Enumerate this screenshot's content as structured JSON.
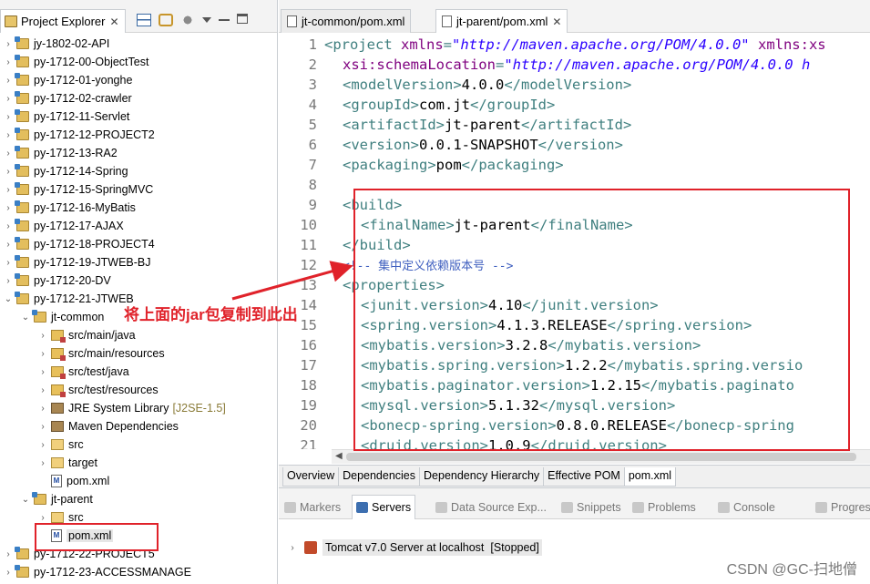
{
  "explorer": {
    "tab_label": "Project Explorer",
    "close_glyph": "✕",
    "tree": [
      {
        "label": "jy-1802-02-API",
        "type": "project",
        "indent": 0,
        "arrow": "›"
      },
      {
        "label": "py-1712-00-ObjectTest",
        "type": "project",
        "indent": 0,
        "arrow": "›"
      },
      {
        "label": "py-1712-01-yonghe",
        "type": "project",
        "indent": 0,
        "arrow": "›"
      },
      {
        "label": "py-1712-02-crawler",
        "type": "project",
        "indent": 0,
        "arrow": "›"
      },
      {
        "label": "py-1712-11-Servlet",
        "type": "project",
        "indent": 0,
        "arrow": "›"
      },
      {
        "label": "py-1712-12-PROJECT2",
        "type": "project",
        "indent": 0,
        "arrow": "›"
      },
      {
        "label": "py-1712-13-RA2",
        "type": "project",
        "indent": 0,
        "arrow": "›"
      },
      {
        "label": "py-1712-14-Spring",
        "type": "project",
        "indent": 0,
        "arrow": "›"
      },
      {
        "label": "py-1712-15-SpringMVC",
        "type": "project",
        "indent": 0,
        "arrow": "›"
      },
      {
        "label": "py-1712-16-MyBatis",
        "type": "project",
        "indent": 0,
        "arrow": "›"
      },
      {
        "label": "py-1712-17-AJAX",
        "type": "project",
        "indent": 0,
        "arrow": "›"
      },
      {
        "label": "py-1712-18-PROJECT4",
        "type": "project",
        "indent": 0,
        "arrow": "›"
      },
      {
        "label": "py-1712-19-JTWEB-BJ",
        "type": "project",
        "indent": 0,
        "arrow": "›"
      },
      {
        "label": "py-1712-20-DV",
        "type": "project",
        "indent": 0,
        "arrow": "›"
      },
      {
        "label": "py-1712-21-JTWEB",
        "type": "project",
        "indent": 0,
        "arrow": "⌄"
      },
      {
        "label": "jt-common",
        "type": "project",
        "indent": 1,
        "arrow": "⌄"
      },
      {
        "label": "src/main/java",
        "type": "srcfolder",
        "indent": 2,
        "arrow": "›"
      },
      {
        "label": "src/main/resources",
        "type": "srcfolder",
        "indent": 2,
        "arrow": "›"
      },
      {
        "label": "src/test/java",
        "type": "srcfolder",
        "indent": 2,
        "arrow": "›"
      },
      {
        "label": "src/test/resources",
        "type": "srcfolder",
        "indent": 2,
        "arrow": "›"
      },
      {
        "label": "JRE System Library",
        "deco": "[J2SE-1.5]",
        "type": "jar",
        "indent": 2,
        "arrow": "›"
      },
      {
        "label": "Maven Dependencies",
        "type": "jar",
        "indent": 2,
        "arrow": "›"
      },
      {
        "label": "src",
        "type": "folder",
        "indent": 2,
        "arrow": "›"
      },
      {
        "label": "target",
        "type": "folder",
        "indent": 2,
        "arrow": "›"
      },
      {
        "label": "pom.xml",
        "type": "xml",
        "indent": 2,
        "arrow": ""
      },
      {
        "label": "jt-parent",
        "type": "project",
        "indent": 1,
        "arrow": "⌄"
      },
      {
        "label": "src",
        "type": "folder",
        "indent": 2,
        "arrow": "›"
      },
      {
        "label": "pom.xml",
        "type": "xml",
        "indent": 2,
        "arrow": "",
        "selected": true
      },
      {
        "label": "py-1712-22-PROJECT5",
        "type": "project",
        "indent": 0,
        "arrow": "›"
      },
      {
        "label": "py-1712-23-ACCESSMANAGE",
        "type": "project",
        "indent": 0,
        "arrow": "›"
      }
    ]
  },
  "editor": {
    "tabs": [
      {
        "label": "jt-common/pom.xml",
        "active": false
      },
      {
        "label": "jt-parent/pom.xml",
        "active": true
      }
    ],
    "lines": [
      {
        "n": "1",
        "fold": "⊖",
        "indent": 0,
        "parts": [
          [
            "tag",
            "<project "
          ],
          [
            "attr",
            "xmlns"
          ],
          [
            "tag",
            "="
          ],
          [
            "aval",
            "\"http://maven.apache.org/POM/4.0.0\""
          ],
          [
            "tag",
            " "
          ],
          [
            "attr",
            "xmlns:xs"
          ]
        ]
      },
      {
        "n": "2",
        "indent": 2,
        "parts": [
          [
            "attr",
            "xsi:schemaLocation"
          ],
          [
            "tag",
            "="
          ],
          [
            "aval",
            "\"http://maven.apache.org/POM/4.0.0 h"
          ]
        ]
      },
      {
        "n": "3",
        "indent": 2,
        "parts": [
          [
            "tag",
            "<modelVersion>"
          ],
          [
            "txt",
            "4.0.0"
          ],
          [
            "tag",
            "</modelVersion>"
          ]
        ]
      },
      {
        "n": "4",
        "indent": 2,
        "parts": [
          [
            "tag",
            "<groupId>"
          ],
          [
            "txt",
            "com.jt"
          ],
          [
            "tag",
            "</groupId>"
          ]
        ]
      },
      {
        "n": "5",
        "indent": 2,
        "parts": [
          [
            "tag",
            "<artifactId>"
          ],
          [
            "txt",
            "jt-parent"
          ],
          [
            "tag",
            "</artifactId>"
          ]
        ]
      },
      {
        "n": "6",
        "indent": 2,
        "parts": [
          [
            "tag",
            "<version>"
          ],
          [
            "txt",
            "0.0.1-SNAPSHOT"
          ],
          [
            "tag",
            "</version>"
          ]
        ]
      },
      {
        "n": "7",
        "indent": 2,
        "parts": [
          [
            "tag",
            "<packaging>"
          ],
          [
            "txt",
            "pom"
          ],
          [
            "tag",
            "</packaging>"
          ]
        ]
      },
      {
        "n": "8",
        "indent": 0,
        "parts": []
      },
      {
        "n": "9",
        "fold": "⊖",
        "indent": 2,
        "parts": [
          [
            "tag",
            "<build>"
          ]
        ]
      },
      {
        "n": "10",
        "indent": 4,
        "parts": [
          [
            "tag",
            "<finalName>"
          ],
          [
            "txt",
            "jt-parent"
          ],
          [
            "tag",
            "</finalName>"
          ]
        ]
      },
      {
        "n": "11",
        "indent": 2,
        "parts": [
          [
            "tag",
            "</build>"
          ]
        ]
      },
      {
        "n": "12",
        "indent": 2,
        "parts": [
          [
            "cm",
            "<!-- 集中定义依赖版本号 -->"
          ]
        ]
      },
      {
        "n": "13",
        "fold": "⊖",
        "indent": 2,
        "parts": [
          [
            "tag",
            "<properties>"
          ]
        ]
      },
      {
        "n": "14",
        "indent": 4,
        "parts": [
          [
            "tag",
            "<junit.version>"
          ],
          [
            "txt",
            "4.10"
          ],
          [
            "tag",
            "</junit.version>"
          ]
        ]
      },
      {
        "n": "15",
        "indent": 4,
        "parts": [
          [
            "tag",
            "<spring.version>"
          ],
          [
            "txt",
            "4.1.3.RELEASE"
          ],
          [
            "tag",
            "</spring.version>"
          ]
        ]
      },
      {
        "n": "16",
        "indent": 4,
        "parts": [
          [
            "tag",
            "<mybatis.version>"
          ],
          [
            "txt",
            "3.2.8"
          ],
          [
            "tag",
            "</mybatis.version>"
          ]
        ]
      },
      {
        "n": "17",
        "indent": 4,
        "parts": [
          [
            "tag",
            "<mybatis.spring.version>"
          ],
          [
            "txt",
            "1.2.2"
          ],
          [
            "tag",
            "</mybatis.spring.versio"
          ]
        ]
      },
      {
        "n": "18",
        "indent": 4,
        "parts": [
          [
            "tag",
            "<mybatis.paginator.version>"
          ],
          [
            "txt",
            "1.2.15"
          ],
          [
            "tag",
            "</mybatis.paginato"
          ]
        ]
      },
      {
        "n": "19",
        "indent": 4,
        "parts": [
          [
            "tag",
            "<mysql.version>"
          ],
          [
            "txt",
            "5.1.32"
          ],
          [
            "tag",
            "</mysql.version>"
          ]
        ]
      },
      {
        "n": "20",
        "indent": 4,
        "parts": [
          [
            "tag",
            "<bonecp-spring.version>"
          ],
          [
            "txt",
            "0.8.0.RELEASE"
          ],
          [
            "tag",
            "</bonecp-spring"
          ]
        ]
      },
      {
        "n": "21",
        "indent": 4,
        "parts": [
          [
            "tag",
            "<druid.version>"
          ],
          [
            "txt",
            "1.0.9"
          ],
          [
            "tag",
            "</druid.version>"
          ]
        ]
      }
    ],
    "pom_tabs": [
      {
        "label": "Overview",
        "active": false
      },
      {
        "label": "Dependencies",
        "active": false
      },
      {
        "label": "Dependency Hierarchy",
        "active": false
      },
      {
        "label": "Effective POM",
        "active": false
      },
      {
        "label": "pom.xml",
        "active": true
      }
    ]
  },
  "bottom": {
    "tabs": [
      {
        "label": "Markers",
        "active": false
      },
      {
        "label": "Servers",
        "active": true
      },
      {
        "label": "Data Source Exp...",
        "active": false
      },
      {
        "label": "Snippets",
        "active": false
      },
      {
        "label": "Problems",
        "active": false
      },
      {
        "label": "Console",
        "active": false
      },
      {
        "label": "Progress",
        "active": false
      }
    ],
    "server": {
      "label": "Tomcat v7.0 Server at localhost",
      "status": "[Stopped]",
      "arrow": "›"
    }
  },
  "annotation": {
    "text": "将上面的jar包复制到此出",
    "color": "#e0222a"
  },
  "watermark": "CSDN @GC-扫地僧"
}
